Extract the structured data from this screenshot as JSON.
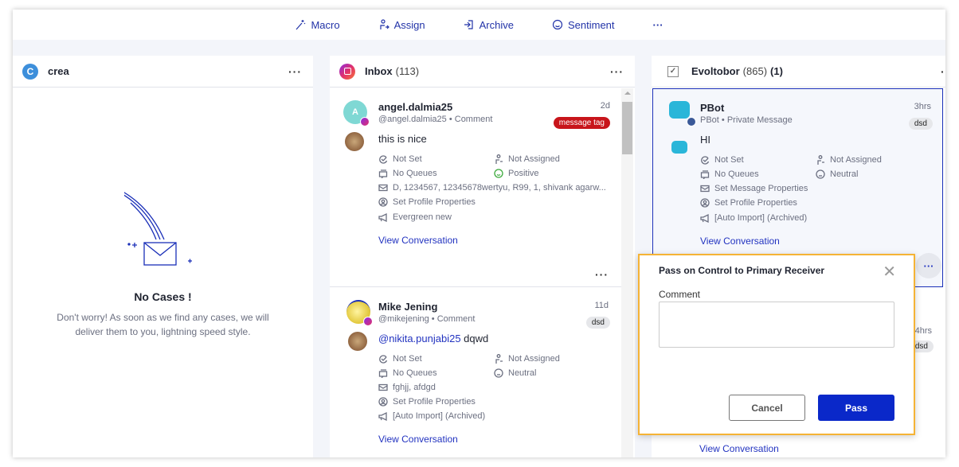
{
  "toolbar": {
    "items": [
      {
        "label": "Macro",
        "icon": "magic-wand-icon"
      },
      {
        "label": "Assign",
        "icon": "assign-user-icon"
      },
      {
        "label": "Archive",
        "icon": "archive-icon"
      },
      {
        "label": "Sentiment",
        "icon": "smile-icon"
      }
    ],
    "more": "···"
  },
  "columns": [
    {
      "title": "crea",
      "count": "",
      "empty": {
        "title": "No Cases !",
        "desc1": "Don't worry! As soon as we find any cases, we will",
        "desc2": "deliver them to you, lightning speed style."
      }
    },
    {
      "title": "Inbox",
      "count": "(113)",
      "cards": [
        {
          "avatar_letter": "A",
          "name": "angel.dalmia25",
          "handle": "@angel.dalmia25",
          "type": "Comment",
          "time": "2d",
          "tag": "message tag",
          "tag_color": "#c8151b",
          "message": "this is nice",
          "status": "Not Set",
          "assignee": "Not Assigned",
          "queues": "No Queues",
          "sentiment": "Positive",
          "message_props": "D, 1234567, 12345678wertyu, R99, 1, shivank agarw...",
          "profile_props": "Set Profile Properties",
          "campaign": "Evergreen new",
          "link": "View Conversation"
        },
        {
          "name": "Mike Jening",
          "handle": "@mikejening",
          "type": "Comment",
          "time": "11d",
          "tag": "dsd",
          "mention": "@nikita.punjabi25",
          "message": " dqwd",
          "status": "Not Set",
          "assignee": "Not Assigned",
          "queues": "No Queues",
          "sentiment": "Neutral",
          "message_props": "fghjj, afdgd",
          "profile_props": "Set Profile Properties",
          "campaign": "[Auto Import] (Archived)",
          "link": "View Conversation"
        }
      ]
    },
    {
      "title": "Evoltobor",
      "count": "(865)",
      "selected": "(1)",
      "cards": [
        {
          "name": "PBot",
          "handle": "PBot",
          "type": "Private Message",
          "time": "3hrs",
          "tag": "dsd",
          "message": "HI",
          "status": "Not Set",
          "assignee": "Not Assigned",
          "queues": "No Queues",
          "sentiment": "Neutral",
          "message_props": "Set Message Properties",
          "profile_props": "Set Profile Properties",
          "campaign": "[Auto Import] (Archived)",
          "link": "View Conversation"
        },
        {
          "time": "4hrs",
          "tag": "dsd",
          "link": "View Conversation"
        }
      ]
    }
  ],
  "dialog": {
    "title": "Pass on Control to Primary Receiver",
    "comment_label": "Comment",
    "comment_value": "",
    "cancel": "Cancel",
    "pass": "Pass"
  },
  "colors": {
    "accent": "#0a28c9",
    "link": "#2233c0",
    "dialog_border": "#f5b335",
    "tag_red": "#c8151b"
  }
}
